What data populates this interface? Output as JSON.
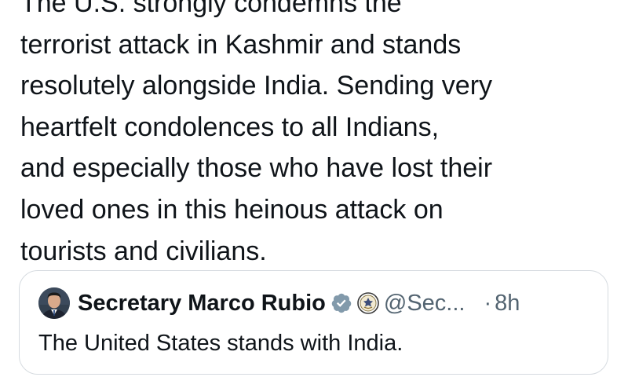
{
  "tweet": {
    "lines": [
      "The U.S. strongly condemns the",
      "terrorist attack in Kashmir and stands",
      "resolutely alongside India. Sending very",
      "heartfelt condolences to all Indians,",
      "and especially those who have lost their",
      "loved ones in this heinous attack on",
      "tourists and civilians."
    ]
  },
  "quote": {
    "author_name": "Secretary Marco Rubio",
    "handle": "@Sec...",
    "separator": "·",
    "time": "8h",
    "text": "The United States stands with India.",
    "icons": {
      "avatar": "avatar-photo",
      "verified": "verified-badge-icon",
      "affiliation": "state-department-seal-icon"
    },
    "colors": {
      "verified_badge": "#829aab",
      "handle_gray": "#536471",
      "border": "#d6dbe0",
      "text": "#0f1419"
    }
  }
}
